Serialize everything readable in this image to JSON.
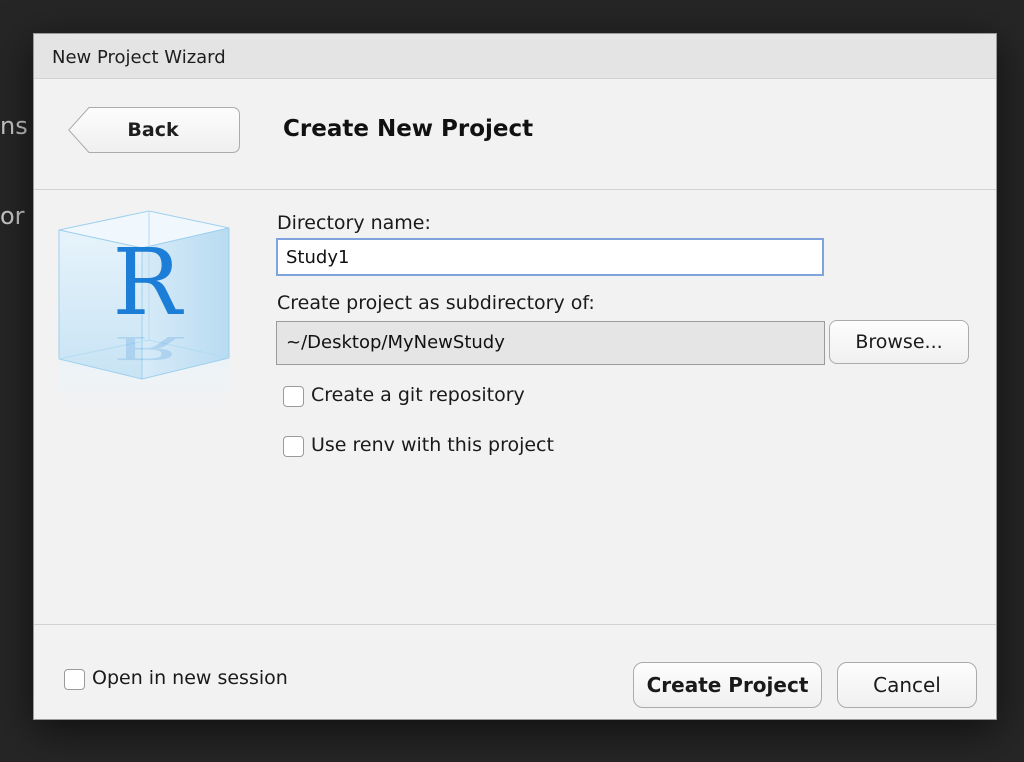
{
  "background": {
    "text_1": "ns",
    "text_2": "or"
  },
  "dialog": {
    "title": "New Project Wizard",
    "back_label": "Back",
    "heading": "Create New Project",
    "logo_letter": "R",
    "directory_name_label": "Directory name:",
    "directory_name_value": "Study1",
    "subdirectory_label": "Create project as subdirectory of:",
    "subdirectory_value": "~/Desktop/MyNewStudy",
    "browse_label": "Browse...",
    "git_label": "Create a git repository",
    "git_checked": false,
    "renv_label": "Use renv with this project",
    "renv_checked": false,
    "session_label": "Open in new session",
    "session_checked": false,
    "create_label": "Create Project",
    "cancel_label": "Cancel"
  },
  "colors": {
    "accent_focus": "#7fa3dc",
    "logo_blue": "#1c7ed6",
    "dialog_bg": "#f2f2f2",
    "desktop_bg": "#262626"
  }
}
